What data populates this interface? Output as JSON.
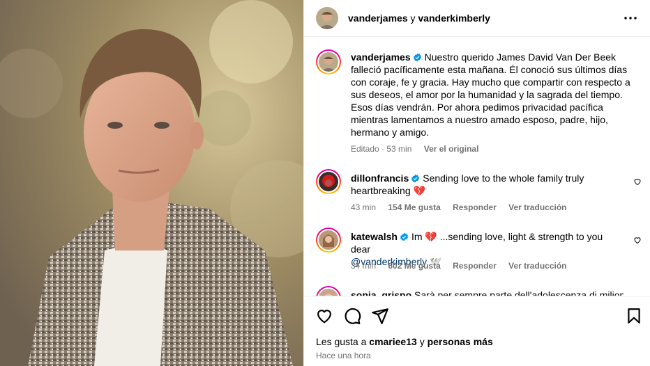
{
  "header": {
    "user1": "vanderjames",
    "connector": "y",
    "user2": "vanderkimberly"
  },
  "caption": {
    "username": "vanderjames",
    "text": "Nuestro querido James David Van Der Beek falleció pacíficamente esta mañana. Él conoció sus últimos días con coraje, fe y gracia. Hay mucho que compartir con respecto a sus deseos, el amor por la humanidad y la sagrada del tiempo. Esos días vendrán. Por ahora pedimos privacidad pacífica mientras lamentamos a nuestro amado esposo, padre, hijo, hermano y amigo.",
    "edited": "Editado · 53 min",
    "see_original": "Ver el original"
  },
  "comments": [
    {
      "username": "dillonfrancis",
      "text": "Sending love to the whole family truly heartbreaking 💔",
      "time": "43 min",
      "likes": "154 Me gusta",
      "reply": "Responder",
      "translate": "Ver traducción"
    },
    {
      "username": "katewalsh",
      "text": "Im 💔 ...sending love, light & strength to you dear",
      "mention": "@vanderkimberly",
      "emoji": "🕊️",
      "time": "34 min",
      "likes": "602 Me gusta",
      "reply": "Responder",
      "translate": "Ver traducción"
    },
    {
      "username": "sonja_grispo",
      "text": "Sarà per sempre parte dell'adolescenza di milioni"
    }
  ],
  "footer": {
    "likes_prefix": "Les gusta a",
    "likes_user": "cmariee13",
    "likes_connector": "y",
    "likes_suffix": "personas más",
    "time_ago": "Hace una hora"
  },
  "icons": {
    "more": "more-options-icon",
    "like": "heart-icon",
    "comment": "comment-icon",
    "share": "share-icon",
    "save": "bookmark-icon",
    "verified": "verified-badge-icon"
  },
  "colors": {
    "verified": "#0095f6",
    "secondary_text": "#737373",
    "mention": "#00376b",
    "broken_heart": "#e0245e"
  }
}
